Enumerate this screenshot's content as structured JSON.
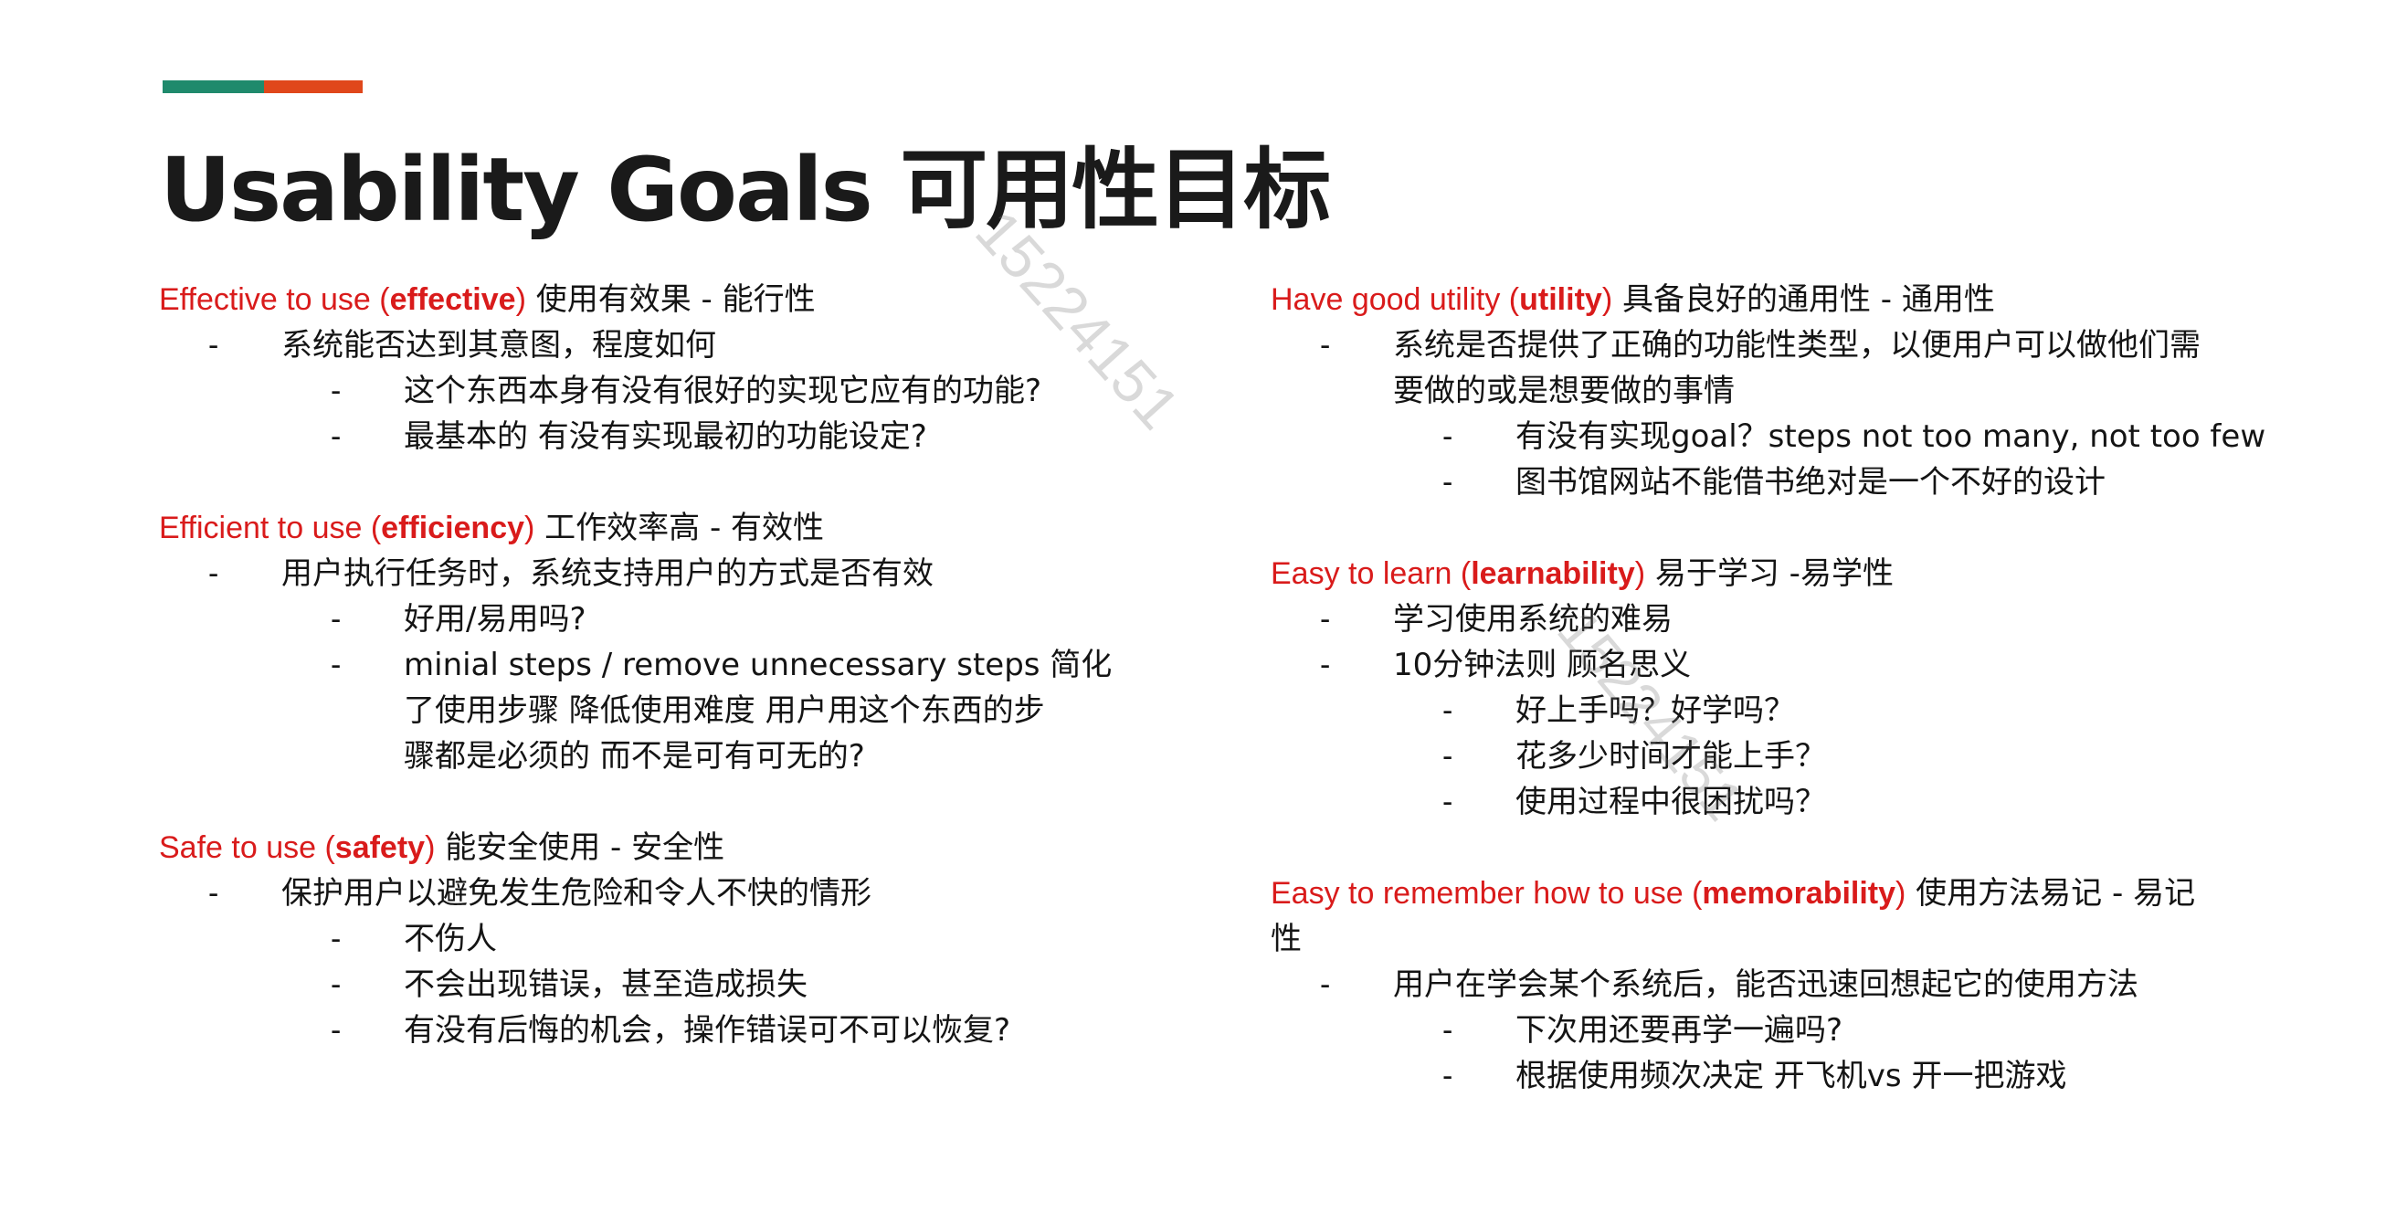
{
  "colors": {
    "accent_teal": "#1f8a6c",
    "accent_orange": "#e0471b",
    "heading_red": "#d91b1b"
  },
  "title": "Usability Goals 可用性目标",
  "watermark": [
    "15224151",
    "15224151"
  ],
  "left": {
    "effective": {
      "en": "Effective to use (",
      "kw": "effective",
      "en_close": ")",
      "zh": " 使用有效果 - 能行性",
      "b1": "系统能否达到其意图，程度如何",
      "b1_1": "这个东西本身有没有很好的实现它应有的功能?",
      "b1_2": "最基本的 有没有实现最初的功能设定?"
    },
    "efficient": {
      "en": "Efficient to use (",
      "kw": "efficiency",
      "en_close": ")",
      "zh": " 工作效率高 - 有效性",
      "b1": "用户执行任务时，系统支持用户的方式是否有效",
      "b1_1": "好用/易用吗?",
      "b1_2_line1": "minial steps / remove unnecessary steps 简化",
      "b1_2_line2": "了使用步骤 降低使用难度 用户用这个东西的步",
      "b1_2_line3": "骤都是必须的 而不是可有可无的?"
    },
    "safe": {
      "en": "Safe to use (",
      "kw": "safety",
      "en_close": ")",
      "zh": " 能安全使用 - 安全性",
      "b1": "保护用户以避免发生危险和令人不快的情形",
      "b1_1": "不伤人",
      "b1_2": "不会出现错误，甚至造成损失",
      "b1_3": "有没有后悔的机会，操作错误可不可以恢复?"
    }
  },
  "right": {
    "utility": {
      "en": "Have good utility (",
      "kw": "utility",
      "en_close": ")",
      "zh": " 具备良好的通用性 - 通用性",
      "b1_line1": "系统是否提供了正确的功能性类型，以便用户可以做他们需",
      "b1_line2": "要做的或是想要做的事情",
      "b1_1": "有没有实现goal？steps not too many, not too few",
      "b1_2": "图书馆网站不能借书绝对是一个不好的设计"
    },
    "learn": {
      "en": "Easy to learn (",
      "kw": "learnability",
      "en_close": ")",
      "zh": " 易于学习 -易学性",
      "b1": "学习使用系统的难易",
      "b2": "10分钟法则 顾名思义",
      "b2_1": "好上手吗？好学吗？",
      "b2_2": "花多少时间才能上手？",
      "b2_3": "使用过程中很困扰吗？"
    },
    "remember": {
      "en": "Easy to remember how to use (",
      "kw": "memorability",
      "en_close": ")",
      "zh": " 使用方法易记 - 易记",
      "zh_cont": "性",
      "b1": "用户在学会某个系统后，能否迅速回想起它的使用方法",
      "b1_1": "下次用还要再学一遍吗?",
      "b1_2": "根据使用频次决定 开飞机vs 开一把游戏"
    }
  },
  "dash": "-"
}
